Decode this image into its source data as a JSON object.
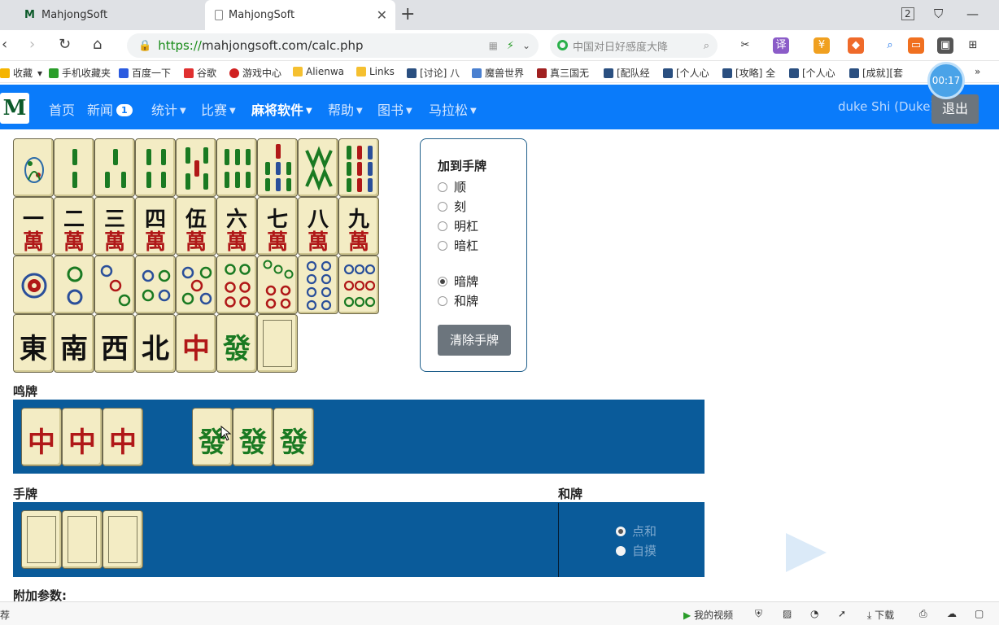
{
  "browser": {
    "tabs": [
      {
        "title": "MahjongSoft"
      },
      {
        "title": "MahjongSoft"
      }
    ],
    "tab_count_badge": "2",
    "url_protocol": "https://",
    "url_rest": "mahjongsoft.com/calc.php",
    "search_placeholder": "中国对日好感度大降",
    "bookmarks": [
      "收藏",
      "手机收藏夹",
      "百度一下",
      "谷歌",
      "游戏中心",
      "Alienwa",
      "Links",
      "[讨论] 八",
      "魔兽世界",
      "真三国无",
      "[配队经",
      "[个人心",
      "[攻略] 全",
      "[个人心",
      "[成就][套"
    ],
    "timer": "00:17",
    "more": "»"
  },
  "site": {
    "logo": "M",
    "nav": [
      {
        "label": "首页",
        "caret": false,
        "active": false
      },
      {
        "label": "新闻",
        "badge": "1",
        "caret": false,
        "active": false
      },
      {
        "label": "统计",
        "caret": true,
        "active": false
      },
      {
        "label": "比赛",
        "caret": true,
        "active": false
      },
      {
        "label": "麻将软件",
        "caret": true,
        "active": true
      },
      {
        "label": "帮助",
        "caret": true,
        "active": false
      },
      {
        "label": "图书",
        "caret": true,
        "active": false
      },
      {
        "label": "马拉松",
        "caret": true,
        "active": false
      }
    ],
    "user": "duke Shi (Duke)",
    "logout": "退出"
  },
  "palette": {
    "row2": [
      {
        "top": "一",
        "bot": "萬"
      },
      {
        "top": "二",
        "bot": "萬"
      },
      {
        "top": "三",
        "bot": "萬"
      },
      {
        "top": "四",
        "bot": "萬"
      },
      {
        "top": "伍",
        "bot": "萬"
      },
      {
        "top": "六",
        "bot": "萬"
      },
      {
        "top": "七",
        "bot": "萬"
      },
      {
        "top": "八",
        "bot": "萬"
      },
      {
        "top": "九",
        "bot": "萬"
      }
    ],
    "honors": [
      {
        "char": "東",
        "color": "#111"
      },
      {
        "char": "南",
        "color": "#111"
      },
      {
        "char": "西",
        "color": "#111"
      },
      {
        "char": "北",
        "color": "#111"
      },
      {
        "char": "中",
        "color": "#b01818"
      },
      {
        "char": "發",
        "color": "#1a7a22"
      }
    ]
  },
  "add_panel": {
    "title": "加到手牌",
    "meld_options": [
      "顺",
      "刻",
      "明杠",
      "暗杠"
    ],
    "type_options": [
      {
        "label": "暗牌",
        "checked": true
      },
      {
        "label": "和牌",
        "checked": false
      }
    ],
    "clear_button": "清除手牌"
  },
  "melds": {
    "label": "鸣牌",
    "groups": [
      {
        "tiles": [
          "中",
          "中",
          "中"
        ],
        "color": "#b01818"
      },
      {
        "tiles": [
          "發",
          "發",
          "發"
        ],
        "color": "#1a7a22"
      }
    ]
  },
  "hand": {
    "label": "手牌",
    "blank_tiles": 3
  },
  "win": {
    "label": "和牌",
    "options": [
      {
        "label": "点和",
        "checked": true
      },
      {
        "label": "自摸",
        "checked": false
      }
    ]
  },
  "extra": {
    "label": "附加参数:"
  },
  "statusbar": {
    "left": "荐",
    "video": "我的视频",
    "download": "下载"
  }
}
